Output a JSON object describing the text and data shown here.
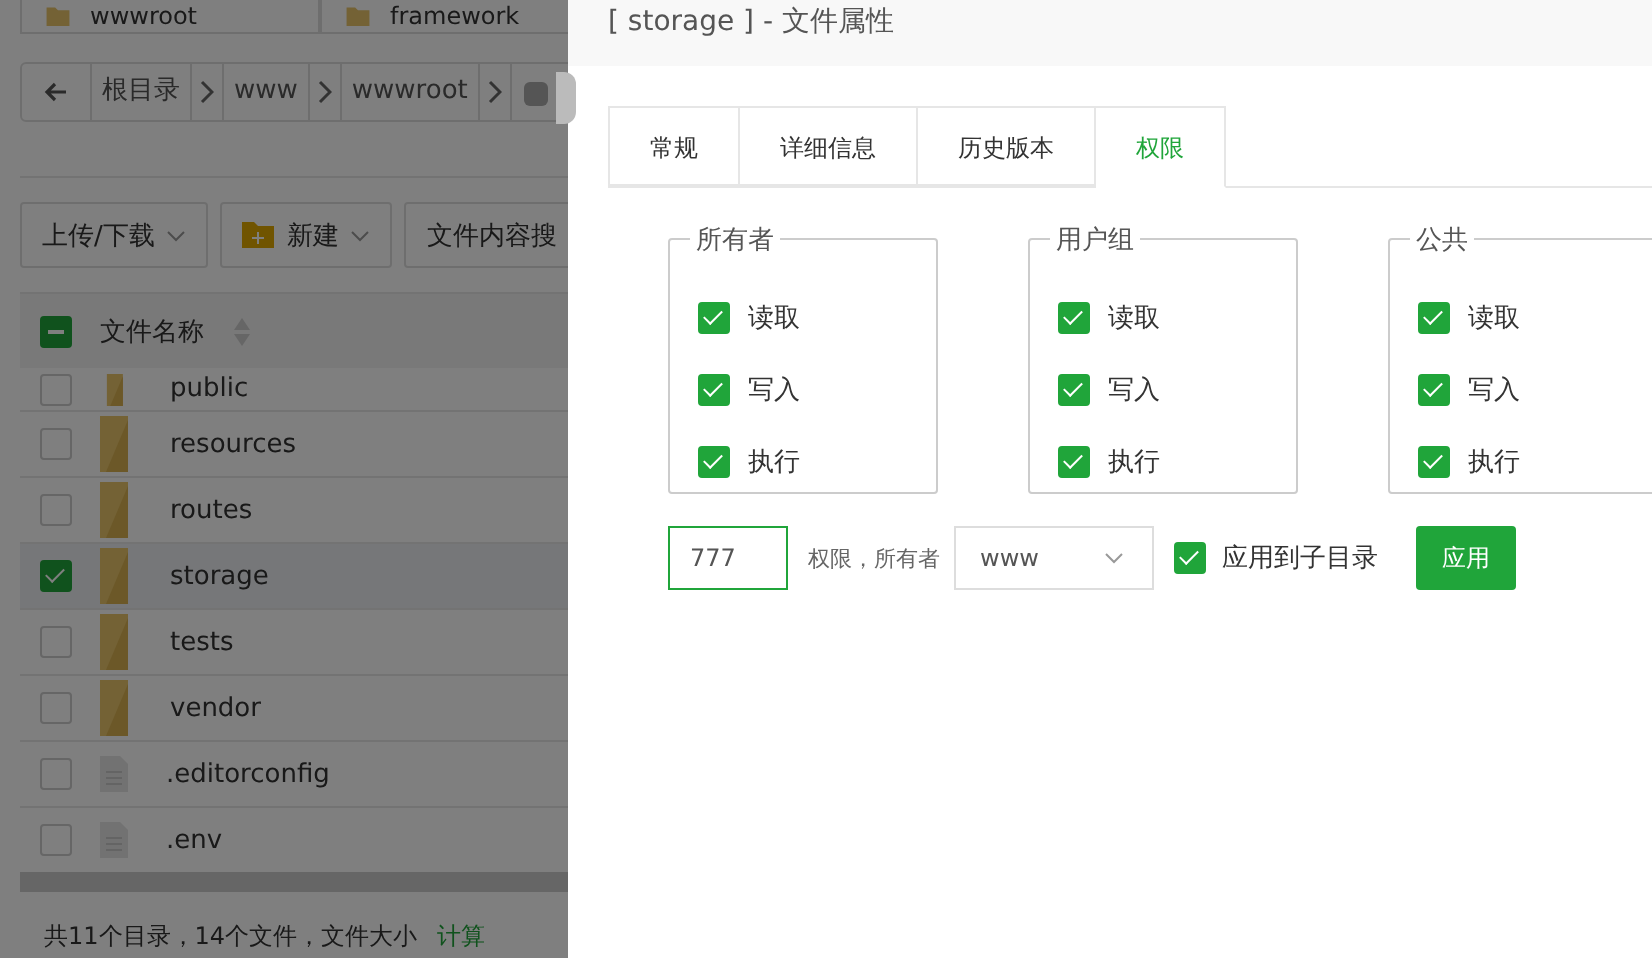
{
  "file_manager": {
    "path_tabs": [
      {
        "label": "wwwroot"
      },
      {
        "label": "framework"
      }
    ],
    "breadcrumb": [
      "根目录",
      "www",
      "wwwroot"
    ],
    "toolbar": [
      {
        "kind": "dropdown",
        "label": "上传/下载"
      },
      {
        "kind": "new",
        "label": "新建"
      },
      {
        "kind": "plain",
        "label": "文件内容搜"
      }
    ],
    "table": {
      "header": {
        "label": "文件名称",
        "indeterminate": true
      },
      "rows": [
        {
          "name": "public",
          "kind": "folder",
          "selected": false
        },
        {
          "name": "resources",
          "kind": "folder",
          "selected": false
        },
        {
          "name": "routes",
          "kind": "folder",
          "selected": false
        },
        {
          "name": "storage",
          "kind": "folder",
          "selected": true
        },
        {
          "name": "tests",
          "kind": "folder",
          "selected": false
        },
        {
          "name": "vendor",
          "kind": "folder",
          "selected": false
        },
        {
          "name": ".editorconfig",
          "kind": "file",
          "selected": false
        },
        {
          "name": ".env",
          "kind": "file",
          "selected": false
        }
      ]
    },
    "footer": {
      "summary": "共11个目录，14个文件，文件大小",
      "link": "计算"
    }
  },
  "dialog": {
    "title": "[ storage ] - 文件属性",
    "tabs": [
      {
        "label": "常规",
        "selected": false
      },
      {
        "label": "详细信息",
        "selected": false
      },
      {
        "label": "历史版本",
        "selected": false
      },
      {
        "label": "权限",
        "selected": true
      }
    ],
    "groups": [
      {
        "title": "所有者",
        "permissions": [
          {
            "label": "读取",
            "checked": true
          },
          {
            "label": "写入",
            "checked": true
          },
          {
            "label": "执行",
            "checked": true
          }
        ]
      },
      {
        "title": "用户组",
        "permissions": [
          {
            "label": "读取",
            "checked": true
          },
          {
            "label": "写入",
            "checked": true
          },
          {
            "label": "执行",
            "checked": true
          }
        ]
      },
      {
        "title": "公共",
        "permissions": [
          {
            "label": "读取",
            "checked": true
          },
          {
            "label": "写入",
            "checked": true
          },
          {
            "label": "执行",
            "checked": true
          }
        ]
      }
    ],
    "mode": "777",
    "owner_label": "权限，所有者",
    "owner": "www",
    "apply_subdirs": {
      "label": "应用到子目录",
      "checked": true
    },
    "apply_button": "应用"
  }
}
